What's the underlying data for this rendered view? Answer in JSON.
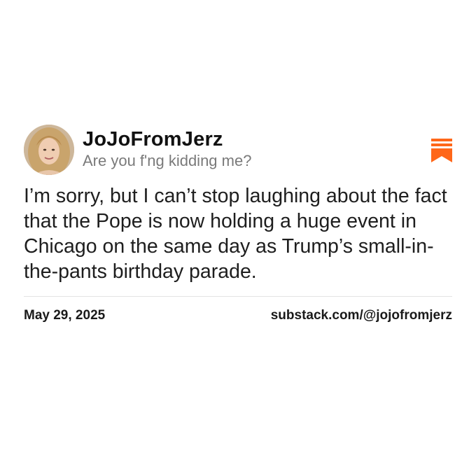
{
  "author": {
    "name": "JoJoFromJerz",
    "subtitle": "Are you f'ng kidding me?"
  },
  "post": {
    "text": "I’m sorry, but I can’t stop laughing about the fact that the Pope is now holding a huge event in Chicago on the same day as Trump’s small-in-the-pants birthday parade."
  },
  "footer": {
    "date": "May 29, 2025",
    "url": "substack.com/@jojofromjerz"
  },
  "icons": {
    "bookmark": "substack-logo-icon",
    "avatar": "profile-photo"
  },
  "colors": {
    "accent": "#FF6719",
    "text": "#1e1e1e",
    "muted": "#7a7a7a",
    "background": "#ffffff"
  }
}
